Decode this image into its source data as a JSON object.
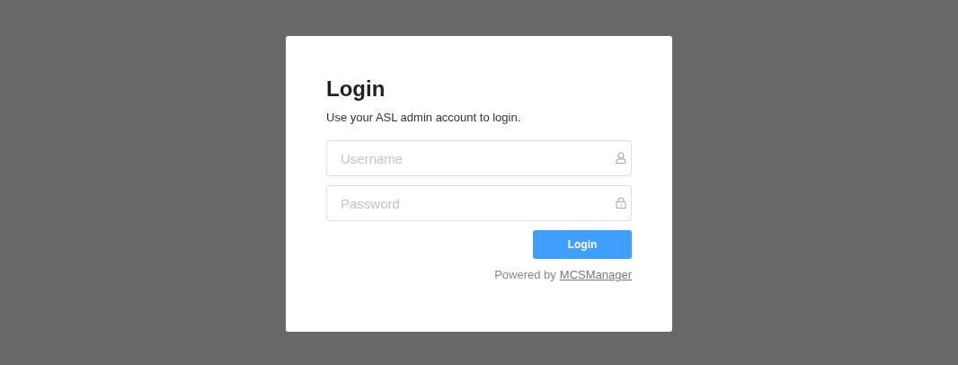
{
  "dialog": {
    "title": "Login",
    "subtitle": "Use your ASL admin account to login.",
    "fields": [
      {
        "kind": "user",
        "placeholder": "Username"
      },
      {
        "kind": "lock",
        "placeholder": "Password"
      }
    ],
    "button": "Login",
    "footer": {
      "text": "Powered by",
      "link": "MCSManager"
    }
  }
}
